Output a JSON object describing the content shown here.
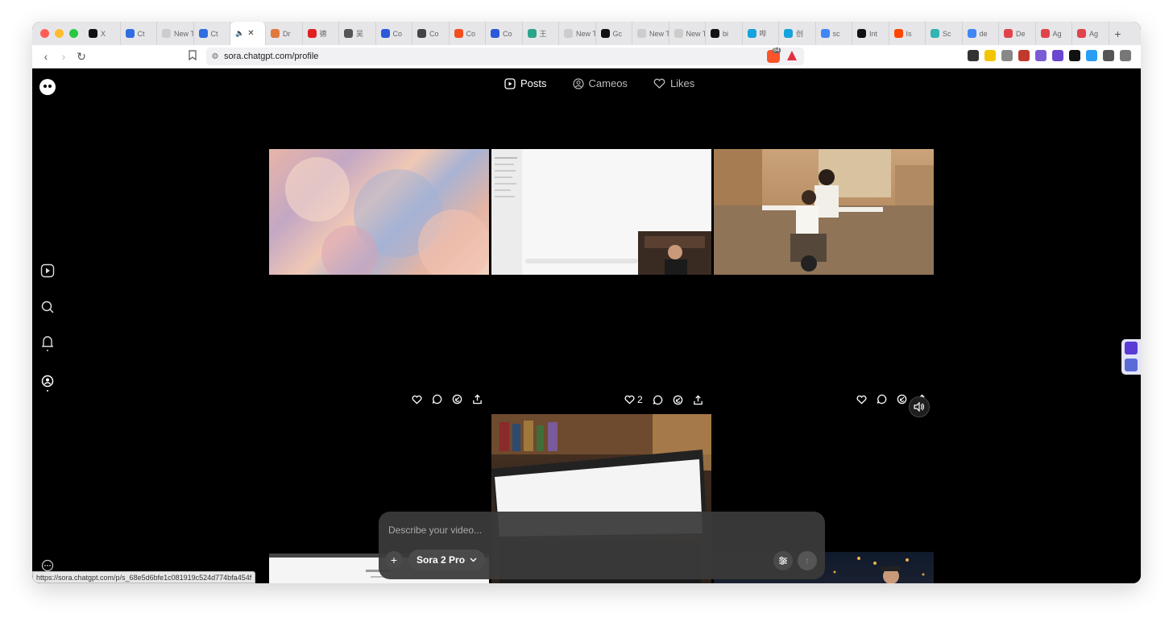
{
  "browser": {
    "tabs": [
      {
        "label": "X",
        "color": "#111111"
      },
      {
        "label": "Ct",
        "color": "#2f6de0"
      },
      {
        "label": "New Ta",
        "color": "#cccccc"
      },
      {
        "label": "Ct",
        "color": "#2f6de0"
      },
      {
        "label": "Dr",
        "color": "#e07a3f"
      },
      {
        "label": "德",
        "color": "#e02020"
      },
      {
        "label": "吴",
        "color": "#555555"
      },
      {
        "label": "Co",
        "color": "#2b59d9"
      },
      {
        "label": "Co",
        "color": "#444444"
      },
      {
        "label": "Co",
        "color": "#f24e1e"
      },
      {
        "label": "Co",
        "color": "#2b59d9"
      },
      {
        "label": "王",
        "color": "#2aa58a"
      },
      {
        "label": "New Ta",
        "color": "#cccccc"
      },
      {
        "label": "Gc",
        "color": "#111111"
      },
      {
        "label": "New Ta",
        "color": "#cccccc"
      },
      {
        "label": "New Ta",
        "color": "#cccccc"
      },
      {
        "label": "bi",
        "color": "#111111"
      },
      {
        "label": "哔",
        "color": "#16a3dc"
      },
      {
        "label": "创",
        "color": "#16a3dc"
      },
      {
        "label": "sc",
        "color": "#4285f4"
      },
      {
        "label": "Int",
        "color": "#111111"
      },
      {
        "label": "Is",
        "color": "#ff4500"
      },
      {
        "label": "Sc",
        "color": "#33b3b3"
      },
      {
        "label": "de",
        "color": "#4285f4"
      },
      {
        "label": "De",
        "color": "#e0434b"
      },
      {
        "label": "Ag",
        "color": "#e0434b"
      },
      {
        "label": "Ag",
        "color": "#e0434b"
      }
    ],
    "url": "sora.chatgpt.com/profile",
    "brave_badge": "84",
    "ext_colors": [
      "#333333",
      "#f2c500",
      "#888888",
      "#c0392b",
      "#7b5cd6",
      "#6b46d1",
      "#111111",
      "#2a9df4",
      "#555555",
      "#777777"
    ]
  },
  "nav": {
    "posts": "Posts",
    "cameos": "Cameos",
    "likes": "Likes"
  },
  "posts": [
    {
      "likes": "",
      "has_sound": false
    },
    {
      "likes": "2",
      "has_sound": false
    },
    {
      "likes": "",
      "has_sound": true
    }
  ],
  "composer": {
    "placeholder": "Describe your video...",
    "model": "Sora 2 Pro"
  },
  "status_url": "https://sora.chatgpt.com/p/s_68e5d6bfe1c081919c524d774bfa454f"
}
